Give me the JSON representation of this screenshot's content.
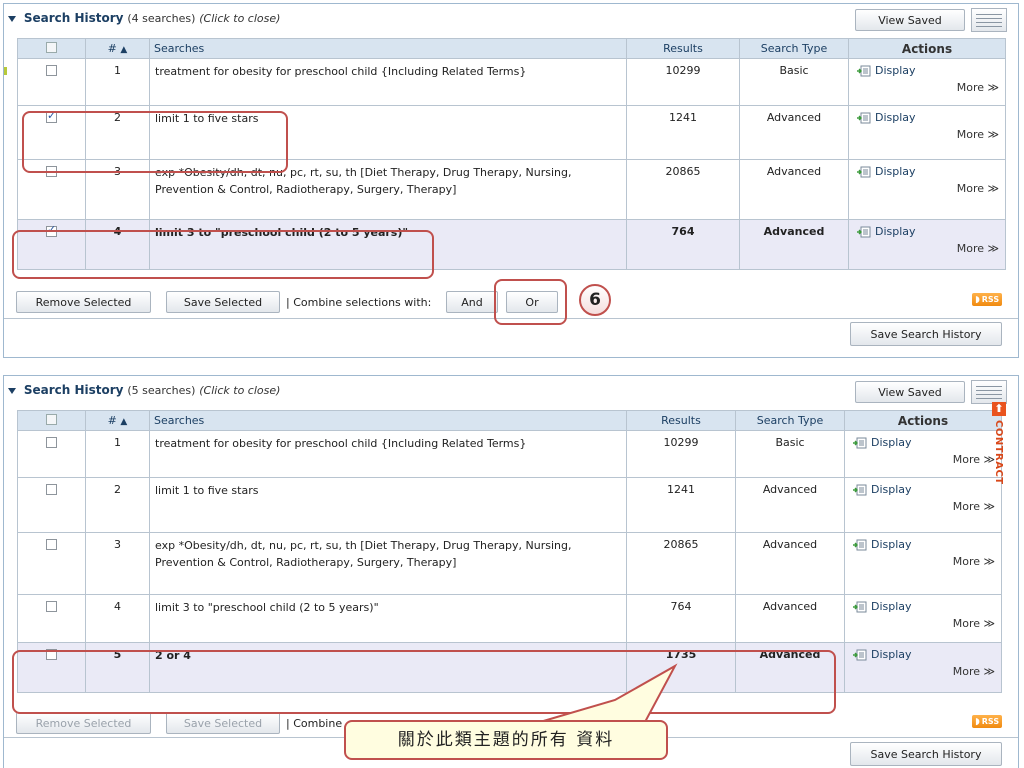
{
  "panel1": {
    "title": "Search History",
    "count": "(4 searches)",
    "hint": "(Click to close)",
    "view_saved": "View Saved",
    "headers": {
      "num": "#",
      "searches": "Searches",
      "results": "Results",
      "type": "Search Type",
      "actions": "Actions"
    },
    "rows": [
      {
        "checked": false,
        "num": "1",
        "search": "treatment for obesity for preschool child {Including Related Terms}",
        "results": "10299",
        "type": "Basic",
        "display": "Display",
        "more": "More ≫"
      },
      {
        "checked": true,
        "num": "2",
        "search": "limit 1 to five stars",
        "results": "1241",
        "type": "Advanced",
        "display": "Display",
        "more": "More ≫"
      },
      {
        "checked": false,
        "num": "3",
        "search": "exp *Obesity/dh, dt, nu, pc, rt, su, th [Diet Therapy, Drug Therapy, Nursing, Prevention & Control, Radiotherapy, Surgery, Therapy]",
        "results": "20865",
        "type": "Advanced",
        "display": "Display",
        "more": "More ≫"
      },
      {
        "checked": true,
        "num": "4",
        "search": "limit 3 to \"preschool child (2 to 5 years)\"",
        "results": "764",
        "type": "Advanced",
        "display": "Display",
        "more": "More ≫"
      }
    ],
    "remove_selected": "Remove Selected",
    "save_selected": "Save Selected",
    "combine_label": "| Combine selections with:",
    "and": "And",
    "or": "Or",
    "rss": "RSS",
    "save_history": "Save Search History"
  },
  "step_number": "6",
  "panel2": {
    "title": "Search History",
    "count": "(5 searches)",
    "hint": "(Click to close)",
    "view_saved": "View Saved",
    "headers": {
      "num": "#",
      "searches": "Searches",
      "results": "Results",
      "type": "Search Type",
      "actions": "Actions"
    },
    "rows": [
      {
        "checked": false,
        "num": "1",
        "search": "treatment for obesity for preschool child {Including Related Terms}",
        "results": "10299",
        "type": "Basic",
        "display": "Display",
        "more": "More ≫"
      },
      {
        "checked": false,
        "num": "2",
        "search": "limit 1 to five stars",
        "results": "1241",
        "type": "Advanced",
        "display": "Display",
        "more": "More ≫"
      },
      {
        "checked": false,
        "num": "3",
        "search": "exp *Obesity/dh, dt, nu, pc, rt, su, th [Diet Therapy, Drug Therapy, Nursing, Prevention & Control, Radiotherapy, Surgery, Therapy]",
        "results": "20865",
        "type": "Advanced",
        "display": "Display",
        "more": "More ≫"
      },
      {
        "checked": false,
        "num": "4",
        "search": "limit 3 to \"preschool child (2 to 5 years)\"",
        "results": "764",
        "type": "Advanced",
        "display": "Display",
        "more": "More ≫"
      },
      {
        "checked": false,
        "num": "5",
        "search": "2 or 4",
        "results": "1735",
        "type": "Advanced",
        "display": "Display",
        "more": "More ≫"
      }
    ],
    "remove_selected": "Remove Selected",
    "save_selected": "Save Selected",
    "combine_label": "| Combine",
    "rss": "RSS",
    "save_history": "Save Search History",
    "contract": "CONTRACT"
  },
  "callout_text": "關於此類主題的所有 資料",
  "colors": {
    "annotation_red": "#c0504d",
    "header_blue": "#d8e4f0",
    "highlight_row": "#eaeaf6",
    "rss_orange": "#f08a10"
  }
}
